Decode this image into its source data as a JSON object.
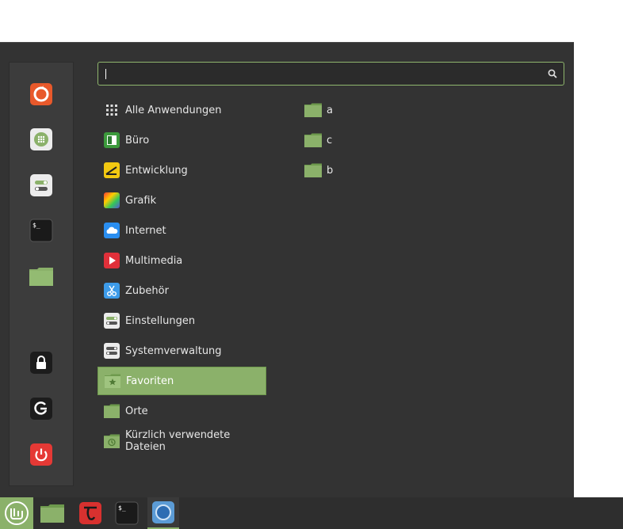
{
  "search": {
    "value": "",
    "placeholder": ""
  },
  "sidebar": {
    "items": [
      {
        "name": "firefox-icon"
      },
      {
        "name": "software-manager-icon"
      },
      {
        "name": "settings-icon"
      },
      {
        "name": "terminal-icon"
      },
      {
        "name": "folder-icon"
      },
      {
        "name": "lock-icon"
      },
      {
        "name": "logout-icon"
      },
      {
        "name": "power-icon"
      }
    ]
  },
  "categories": [
    {
      "label": "Alle Anwendungen"
    },
    {
      "label": "Büro"
    },
    {
      "label": "Entwicklung"
    },
    {
      "label": "Grafik"
    },
    {
      "label": "Internet"
    },
    {
      "label": "Multimedia"
    },
    {
      "label": "Zubehör"
    },
    {
      "label": "Einstellungen"
    },
    {
      "label": "Systemverwaltung"
    },
    {
      "label": "Favoriten"
    },
    {
      "label": "Orte"
    },
    {
      "label": "Kürzlich verwendete Dateien"
    }
  ],
  "selected_category": "Favoriten",
  "apps": [
    {
      "label": "a"
    },
    {
      "label": "c"
    },
    {
      "label": "b"
    }
  ],
  "terminal_prompt": "$_",
  "colors": {
    "accent": "#8bb16a",
    "menu_bg": "#333333",
    "folder": "#8bb16a",
    "power": "#e53935"
  }
}
